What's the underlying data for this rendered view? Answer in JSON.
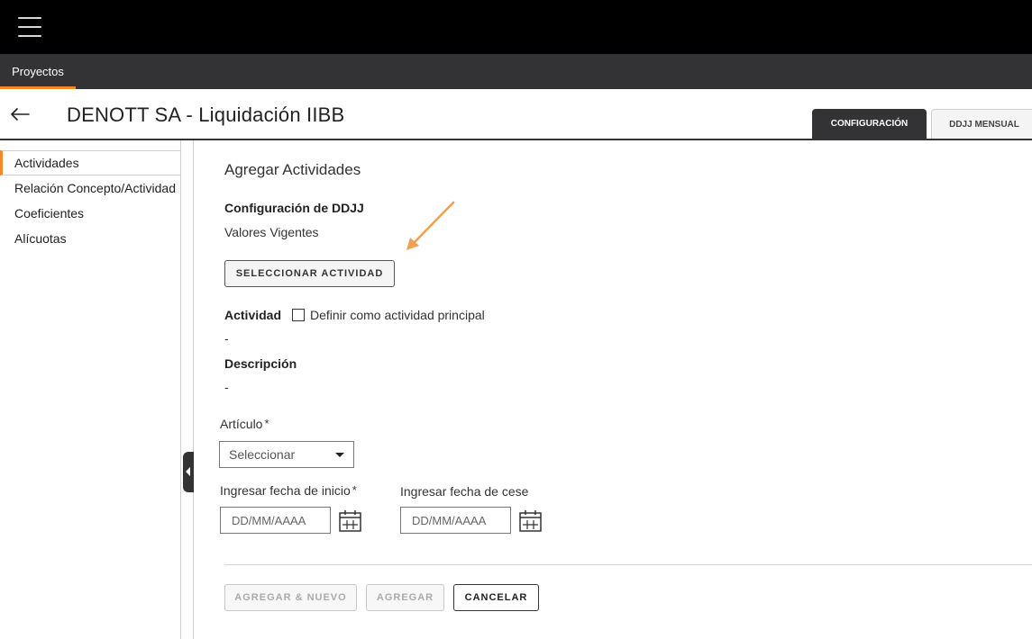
{
  "topbar": {
    "menu_icon": "hamburger-menu-icon"
  },
  "navbar": {
    "tabs": [
      {
        "label": "Proyectos",
        "active": true
      }
    ]
  },
  "header": {
    "back_icon": "arrow-left-icon",
    "title": "DENOTT SA - Liquidación IIBB",
    "tabs": [
      {
        "label": "CONFIGURACIÓN",
        "active": true
      },
      {
        "label": "DDJJ MENSUAL",
        "active": false
      }
    ]
  },
  "sidebar": {
    "items": [
      {
        "label": "Actividades",
        "active": true
      },
      {
        "label": "Relación Concepto/Actividad",
        "active": false
      },
      {
        "label": "Coeficientes",
        "active": false
      },
      {
        "label": "Alícuotas",
        "active": false
      }
    ]
  },
  "main": {
    "title": "Agregar Actividades",
    "config_label": "Configuración de DDJJ",
    "config_value": "Valores Vigentes",
    "select_activity_button": "SELECCIONAR ACTIVIDAD",
    "activity_label": "Actividad",
    "principal_checkbox_label": "Definir como actividad principal",
    "principal_checked": false,
    "activity_value": "-",
    "description_label": "Descripción",
    "description_value": "-",
    "article_label": "Artículo",
    "required_mark": "*",
    "article_select_value": "Seleccionar",
    "start_date_label": "Ingresar fecha de inicio",
    "start_date_placeholder": "DD/MM/AAAA",
    "end_date_label": "Ingresar fecha de cese",
    "end_date_placeholder": "DD/MM/AAAA",
    "calendar_icon": "calendar-icon",
    "buttons": {
      "add_new": "AGREGAR & NUEVO",
      "add": "AGREGAR",
      "cancel": "CANCELAR"
    }
  },
  "colors": {
    "accent": "#f08a24",
    "dark": "#333335",
    "topbar": "#000000"
  }
}
